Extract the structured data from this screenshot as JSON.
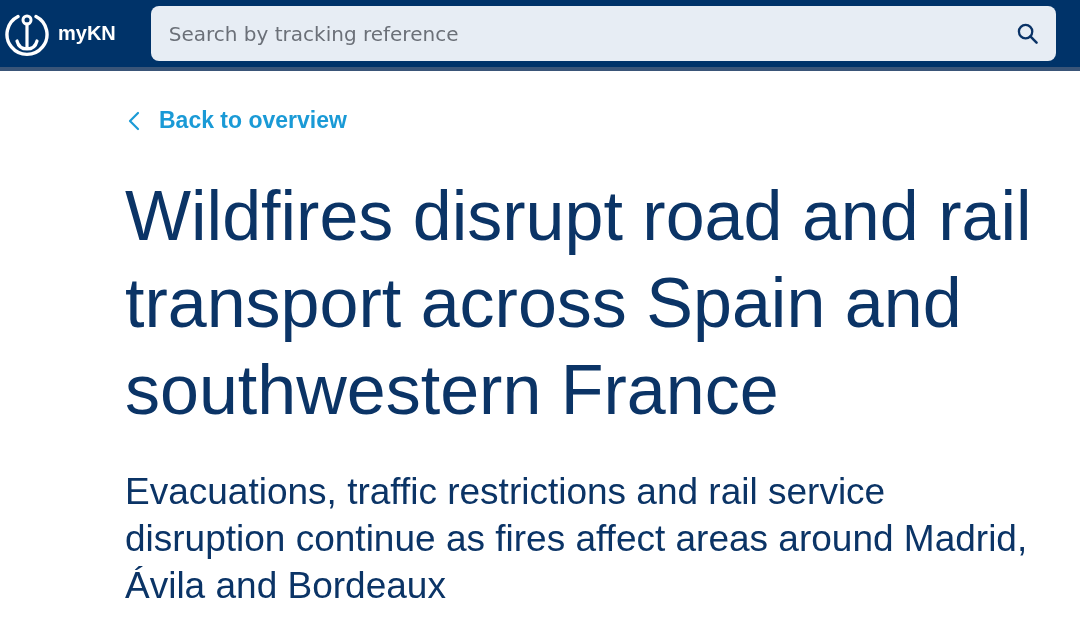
{
  "header": {
    "brand": "myKN",
    "search": {
      "placeholder": "Search by tracking reference"
    }
  },
  "back_link": {
    "label": "Back to overview"
  },
  "article": {
    "title": "Wildfires disrupt road and rail transport across Spain and southwestern France",
    "subtitle": "Evacuations, traffic restrictions and rail service disruption continue as fires affect areas around Madrid, Ávila and Bordeaux"
  }
}
